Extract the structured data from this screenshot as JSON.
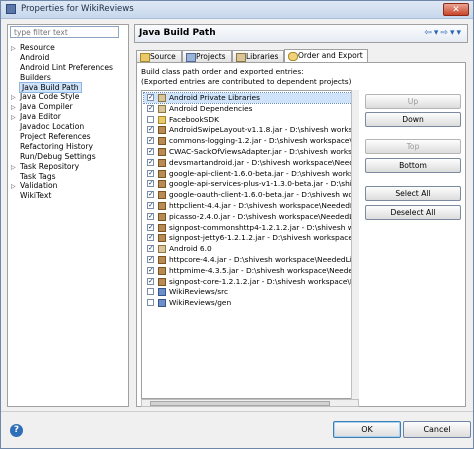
{
  "window": {
    "title": "Properties for WikiReviews",
    "close_label": "✕"
  },
  "filter": {
    "placeholder": "type filter text"
  },
  "tree": [
    {
      "label": "Resource",
      "expander": "▷"
    },
    {
      "label": "Android",
      "expander": ""
    },
    {
      "label": "Android Lint Preferences",
      "expander": ""
    },
    {
      "label": "Builders",
      "expander": ""
    },
    {
      "label": "Java Build Path",
      "expander": "",
      "selected": true
    },
    {
      "label": "Java Code Style",
      "expander": "▷"
    },
    {
      "label": "Java Compiler",
      "expander": "▷"
    },
    {
      "label": "Java Editor",
      "expander": "▷"
    },
    {
      "label": "Javadoc Location",
      "expander": ""
    },
    {
      "label": "Project References",
      "expander": ""
    },
    {
      "label": "Refactoring History",
      "expander": ""
    },
    {
      "label": "Run/Debug Settings",
      "expander": ""
    },
    {
      "label": "Task Repository",
      "expander": "▷"
    },
    {
      "label": "Task Tags",
      "expander": ""
    },
    {
      "label": "Validation",
      "expander": "▷"
    },
    {
      "label": "WikiText",
      "expander": ""
    }
  ],
  "page": {
    "title": "Java Build Path",
    "nav_back": "⇦",
    "nav_back_drop": "▾",
    "nav_fwd": "⇨",
    "nav_fwd_drop": "▾",
    "menu": "▾"
  },
  "tabs": [
    {
      "label": "Source",
      "icon": "source-folder-icon",
      "active": false
    },
    {
      "label": "Projects",
      "icon": "projects-icon",
      "active": false
    },
    {
      "label": "Libraries",
      "icon": "libraries-icon",
      "active": false
    },
    {
      "label": "Order and Export",
      "icon": "order-export-icon",
      "active": true
    }
  ],
  "description": {
    "line1": "Build class path order and exported entries:",
    "line2": "(Exported entries are contributed to dependent projects)"
  },
  "entries": [
    {
      "label": "Android Private Libraries",
      "checked": true,
      "icon": "lib",
      "selected": true
    },
    {
      "label": "Android Dependencies",
      "checked": true,
      "icon": "lib"
    },
    {
      "label": "FacebookSDK",
      "checked": false,
      "icon": "fld"
    },
    {
      "label": "AndroidSwipeLayout-v1.1.8.jar - D:\\shivesh workspace\\",
      "checked": true,
      "icon": "jar"
    },
    {
      "label": "commons-logging-1.2.jar - D:\\shivesh workspace\\Neede",
      "checked": true,
      "icon": "jar"
    },
    {
      "label": "CWAC-SackOfViewsAdapter.jar - D:\\shivesh workspace\\N",
      "checked": true,
      "icon": "jar"
    },
    {
      "label": "devsmartandroid.jar - D:\\shivesh workspace\\NeededLib",
      "checked": true,
      "icon": "jar"
    },
    {
      "label": "google-api-client-1.6.0-beta.jar - D:\\shivesh workspace\\",
      "checked": true,
      "icon": "jar"
    },
    {
      "label": "google-api-services-plus-v1-1.3.0-beta.jar - D:\\shivesh w",
      "checked": true,
      "icon": "jar"
    },
    {
      "label": "google-oauth-client-1.6.0-beta.jar - D:\\shivesh workspace\\",
      "checked": true,
      "icon": "jar"
    },
    {
      "label": "httpclient-4.4.jar - D:\\shivesh workspace\\NeededLib",
      "checked": true,
      "icon": "jar"
    },
    {
      "label": "picasso-2.4.0.jar - D:\\shivesh workspace\\NeededLib",
      "checked": true,
      "icon": "jar"
    },
    {
      "label": "signpost-commonshttp4-1.2.1.2.jar - D:\\shivesh workspac",
      "checked": true,
      "icon": "jar"
    },
    {
      "label": "signpost-jetty6-1.2.1.2.jar - D:\\shivesh workspace\\Neede",
      "checked": true,
      "icon": "jar"
    },
    {
      "label": "Android 6.0",
      "checked": true,
      "icon": "lib"
    },
    {
      "label": "httpcore-4.4.jar - D:\\shivesh workspace\\NeededLib",
      "checked": true,
      "icon": "jar"
    },
    {
      "label": "httpmime-4.3.5.jar - D:\\shivesh workspace\\NeededLib",
      "checked": true,
      "icon": "jar"
    },
    {
      "label": "signpost-core-1.2.1.2.jar - D:\\shivesh workspace\\Neede",
      "checked": true,
      "icon": "jar"
    },
    {
      "label": "WikiReviews/src",
      "checked": false,
      "icon": "src"
    },
    {
      "label": "WikiReviews/gen",
      "checked": false,
      "icon": "src"
    }
  ],
  "buttons": {
    "up": "Up",
    "down": "Down",
    "top": "Top",
    "bottom": "Bottom",
    "select_all": "Select All",
    "deselect_all": "Deselect All"
  },
  "footer": {
    "help": "?",
    "ok": "OK",
    "cancel": "Cancel"
  }
}
